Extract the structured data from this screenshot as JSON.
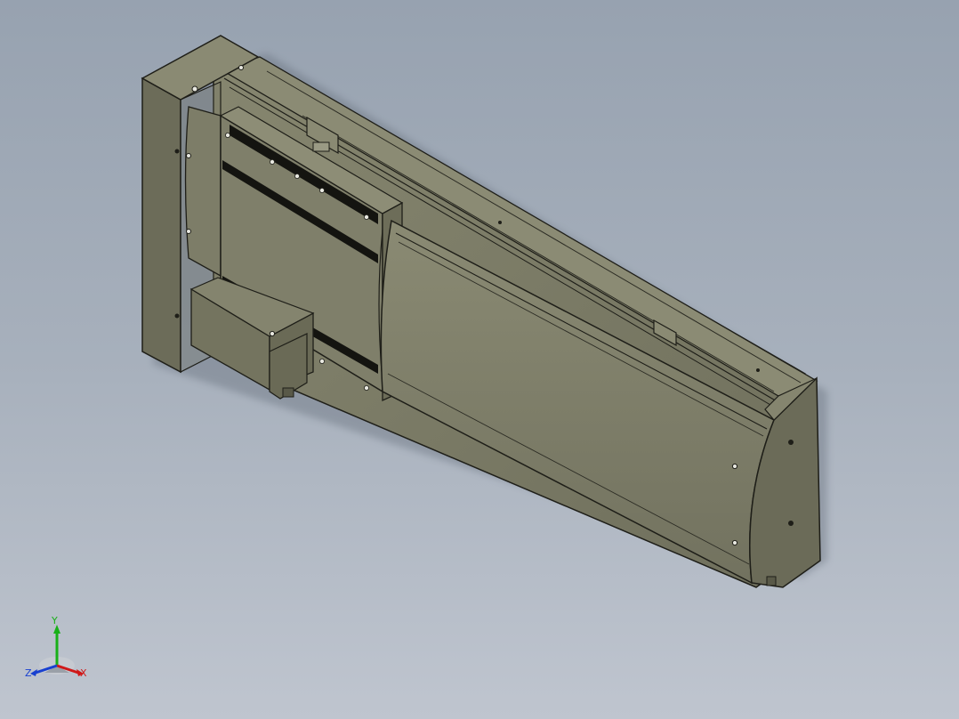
{
  "viewport": {
    "background_top": "#97a2b0",
    "background_bottom": "#bfc5cf",
    "part_color": "#7a7a66",
    "edge_color": "#1e1e18"
  },
  "triad": {
    "x_label": "X",
    "y_label": "Y",
    "z_label": "Z",
    "x_color": "#d01818",
    "y_color": "#18b018",
    "z_color": "#1840d0"
  }
}
